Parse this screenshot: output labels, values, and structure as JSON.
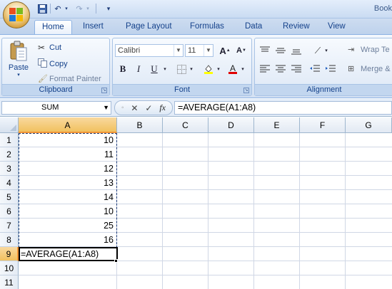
{
  "window": {
    "title": "Book"
  },
  "quick_access": {
    "save": "save-icon",
    "undo": "undo-icon",
    "redo": "redo-icon",
    "customize": "customize-icon"
  },
  "tabs": [
    {
      "label": "Home",
      "active": true
    },
    {
      "label": "Insert"
    },
    {
      "label": "Page Layout"
    },
    {
      "label": "Formulas"
    },
    {
      "label": "Data"
    },
    {
      "label": "Review"
    },
    {
      "label": "View"
    }
  ],
  "clipboard": {
    "paste": "Paste",
    "cut": "Cut",
    "copy": "Copy",
    "format_painter": "Format Painter",
    "group_label": "Clipboard"
  },
  "font": {
    "name": "Calibri",
    "size": "11",
    "group_label": "Font",
    "grow": "A",
    "shrink": "A",
    "bold": "B",
    "italic": "I",
    "underline": "U"
  },
  "alignment": {
    "wrap_text": "Wrap Te",
    "merge": "Merge &",
    "group_label": "Alignment"
  },
  "formula_bar": {
    "name_box": "SUM",
    "formula": "=AVERAGE(A1:A8)",
    "cancel": "✕",
    "enter": "✓",
    "fx": "fx"
  },
  "columns": [
    "A",
    "B",
    "C",
    "D",
    "E",
    "F",
    "G"
  ],
  "rows": [
    "1",
    "2",
    "3",
    "4",
    "5",
    "6",
    "7",
    "8",
    "9",
    "10",
    "11"
  ],
  "cells_A": [
    "10",
    "11",
    "12",
    "13",
    "14",
    "10",
    "25",
    "16"
  ],
  "active_cell": {
    "ref": "A9",
    "content": "=AVERAGE(A1:A8)"
  },
  "colors": {
    "accent": "#15428b",
    "selection_header": "#f9d99f"
  }
}
